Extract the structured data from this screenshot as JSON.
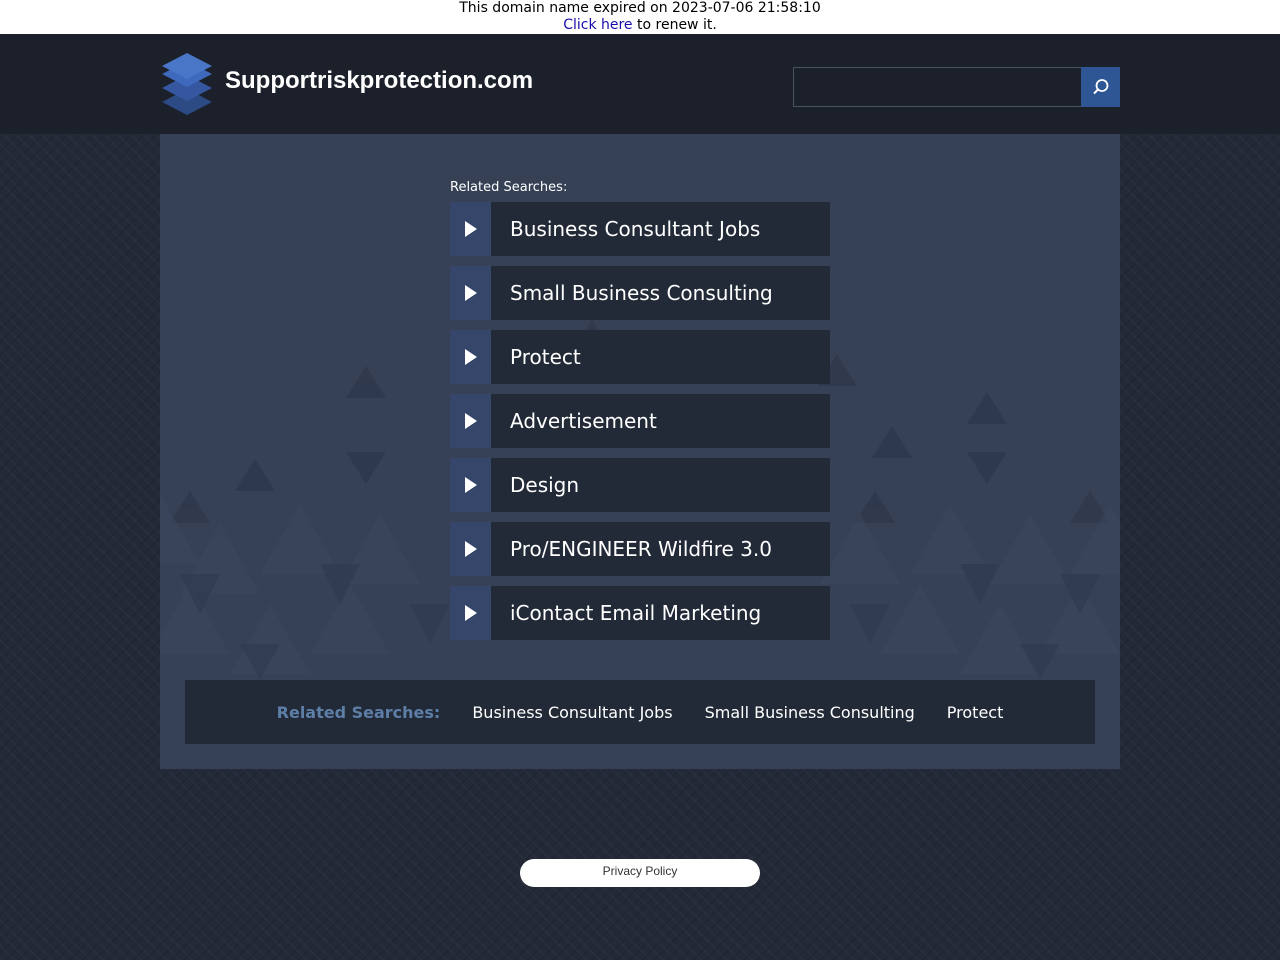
{
  "expiry": {
    "message": "This domain name expired on 2023-07-06 21:58:10",
    "link_text": "Click here",
    "suffix": "to renew it."
  },
  "header": {
    "site_title": "Supportriskprotection.com",
    "logo_icon": "stacked-layers-icon",
    "search_icon": "search-icon",
    "search_placeholder": ""
  },
  "main": {
    "related_label": "Related Searches:",
    "links": [
      {
        "label": "Business Consultant Jobs"
      },
      {
        "label": "Small Business Consulting"
      },
      {
        "label": "Protect"
      },
      {
        "label": "Advertisement"
      },
      {
        "label": "Design"
      },
      {
        "label": "Pro/ENGINEER Wildfire 3.0"
      },
      {
        "label": "iContact Email Marketing"
      }
    ]
  },
  "bottom_bar": {
    "label": "Related Searches:",
    "links": [
      {
        "label": "Business Consultant Jobs"
      },
      {
        "label": "Small Business Consulting"
      },
      {
        "label": "Protect"
      }
    ]
  },
  "footer": {
    "privacy_label": "Privacy Policy"
  },
  "colors": {
    "page_bg": "#232936",
    "header_bg": "#1b202b",
    "panel_bg": "#364156",
    "item_bg": "#232a37",
    "arrow_bg": "#36466a",
    "accent": "#2e5594",
    "muted_label": "#5d7ea7"
  }
}
